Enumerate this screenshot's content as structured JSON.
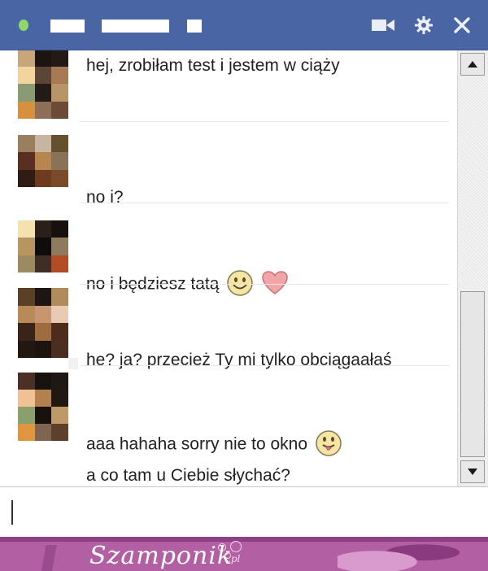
{
  "header": {
    "status": "online",
    "icons": [
      "video-icon",
      "gear-icon",
      "close-icon"
    ]
  },
  "messages": [
    {
      "text": "hej, zrobiłam test i jestem w ciąży"
    },
    {
      "text": "no i?"
    },
    {
      "text": "no i będziesz tatą",
      "emojis": [
        "smile-emoji-icon",
        "heart-icon"
      ]
    },
    {
      "text": "he? ja? przecież Ty mi tylko obciągaałaś"
    },
    {
      "lines": [
        "aaa hahaha sorry nie to okno",
        "a co tam u Ciebie słychać?"
      ],
      "emojis": [
        "tongue-emoji-icon"
      ]
    }
  ],
  "input": {
    "value": ""
  },
  "footer": {
    "brand": "Szamponik",
    "tld": ".pl"
  },
  "colors": {
    "header": "#4a65a4",
    "footer": "#b35fa3",
    "online": "#8fd96b"
  }
}
